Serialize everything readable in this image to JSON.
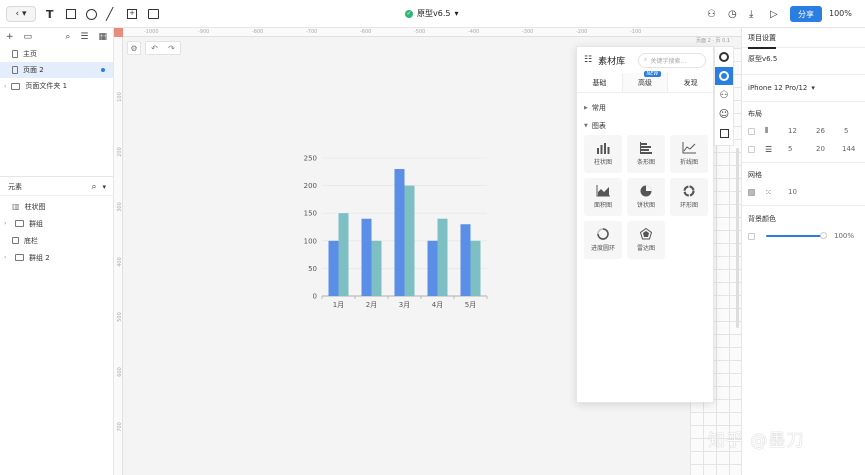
{
  "topbar": {
    "title": "原型v6.5",
    "share_label": "分享",
    "zoom": "100%"
  },
  "left_panel": {
    "pages": [
      {
        "label": "主页",
        "active": false
      },
      {
        "label": "页面 2",
        "active": true
      },
      {
        "label": "页面文件夹 1",
        "active": false
      }
    ],
    "elements_title": "元素",
    "elements": [
      {
        "label": "柱状图"
      },
      {
        "label": "群组"
      },
      {
        "label": "底栏"
      },
      {
        "label": "群组 2"
      }
    ]
  },
  "canvas": {
    "ruler_top": [
      "-1000",
      "-900",
      "-800",
      "-700",
      "-600",
      "-500",
      "-400",
      "-300",
      "-200",
      "-100"
    ],
    "ruler_left": [
      "100",
      "200",
      "300",
      "400",
      "500",
      "600",
      "700"
    ],
    "frame_label": "页面 2 · 页 0.1"
  },
  "chart_data": {
    "type": "bar",
    "categories": [
      "1月",
      "2月",
      "3月",
      "4月",
      "5月"
    ],
    "series": [
      {
        "values": [
          100,
          140,
          230,
          100,
          130
        ],
        "color": "#5b8ee6"
      },
      {
        "values": [
          150,
          100,
          200,
          140,
          100
        ],
        "color": "#7ebfc3"
      }
    ],
    "yticks": [
      "0",
      "50",
      "100",
      "150",
      "200",
      "250"
    ],
    "ylim": [
      0,
      250
    ]
  },
  "library": {
    "title": "素材库",
    "search_placeholder": "关键字搜索...",
    "tabs": [
      {
        "label": "基础",
        "active": false
      },
      {
        "label": "高级",
        "active": true,
        "badge": "NEW"
      },
      {
        "label": "发现",
        "active": false
      }
    ],
    "sections": [
      {
        "label": "常用"
      },
      {
        "label": "图表"
      }
    ],
    "charts": [
      {
        "label": "柱状图",
        "icon": "bar-chart-icon"
      },
      {
        "label": "条形图",
        "icon": "hbar-chart-icon"
      },
      {
        "label": "折线图",
        "icon": "line-chart-icon"
      },
      {
        "label": "面积图",
        "icon": "area-chart-icon"
      },
      {
        "label": "饼状图",
        "icon": "pie-chart-icon"
      },
      {
        "label": "环形图",
        "icon": "donut-chart-icon"
      },
      {
        "label": "进度圆环",
        "icon": "progress-ring-icon"
      },
      {
        "label": "雷达图",
        "icon": "radar-chart-icon"
      }
    ]
  },
  "right_panel": {
    "tab_label": "项目设置",
    "project_name": "原型v6.5",
    "device": "iPhone 12 Pro/12",
    "layout_label": "布局",
    "layout_cols": [
      "12",
      "26",
      "5"
    ],
    "layout_rows": [
      "5",
      "20",
      "144"
    ],
    "grid_label": "网格",
    "grid_value": "10",
    "bg_label": "背景颜色",
    "bg_opacity": "100%"
  },
  "watermark": "知乎 @墨刀"
}
